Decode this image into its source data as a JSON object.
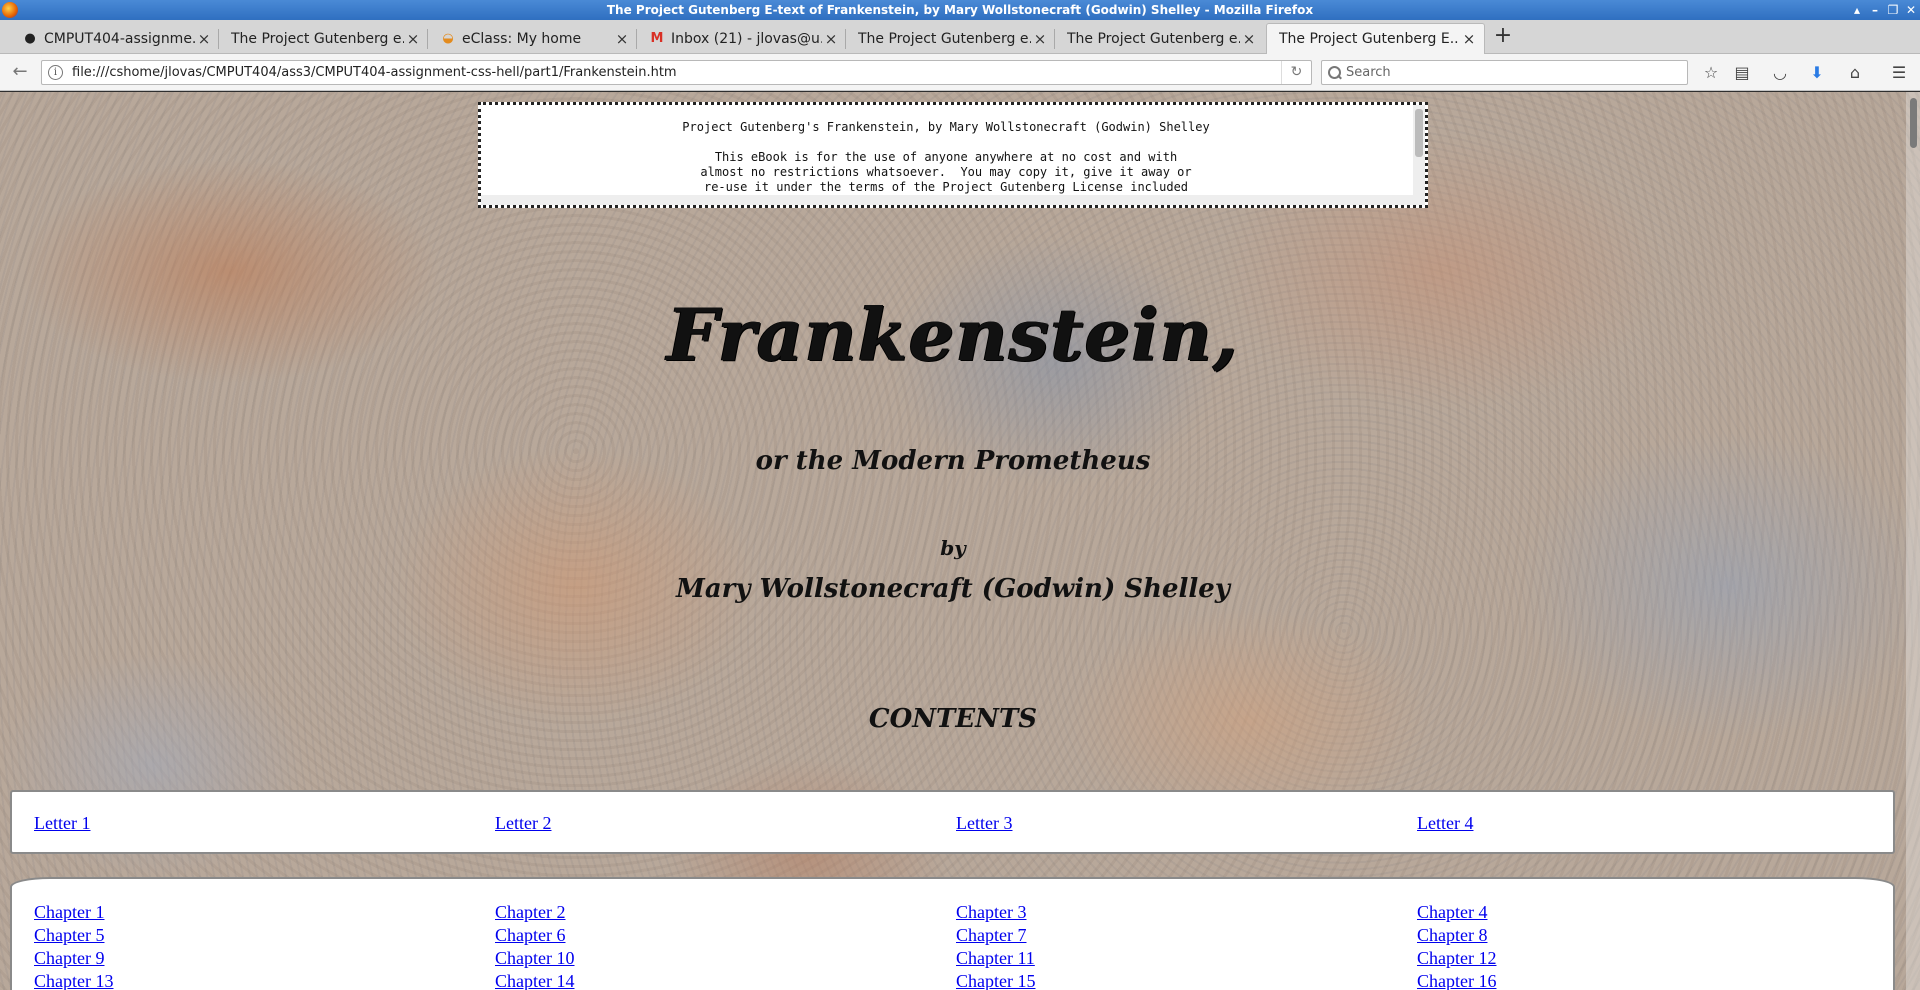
{
  "window": {
    "title": "The Project Gutenberg E-text of Frankenstein, by Mary Wollstonecraft (Godwin) Shelley - Mozilla Firefox"
  },
  "tabs": [
    {
      "title": "CMPUT404-assignme...",
      "icon": "github-icon"
    },
    {
      "title": "The Project Gutenberg e...",
      "icon": "none"
    },
    {
      "title": "eClass: My home",
      "icon": "moodle-icon"
    },
    {
      "title": "Inbox (21) - jlovas@u...",
      "icon": "gmail-icon"
    },
    {
      "title": "The Project Gutenberg e...",
      "icon": "none"
    },
    {
      "title": "The Project Gutenberg e...",
      "icon": "none"
    },
    {
      "title": "The Project Gutenberg E...",
      "icon": "none",
      "active": true
    }
  ],
  "navbar": {
    "url": "file:///cshome/jlovas/CMPUT404/ass3/CMPUT404-assignment-css-hell/part1/Frankenstein.htm",
    "search_placeholder": "Search"
  },
  "page": {
    "license_text": "Project Gutenberg's Frankenstein, by Mary Wollstonecraft (Godwin) Shelley\n\nThis eBook is for the use of anyone anywhere at no cost and with\nalmost no restrictions whatsoever.  You may copy it, give it away or\nre-use it under the terms of the Project Gutenberg License included",
    "title": "Frankenstein,",
    "subtitle": "or the Modern Prometheus",
    "by": "by",
    "author": "Mary Wollstonecraft (Godwin) Shelley",
    "contents_heading": "CONTENTS",
    "letters": [
      "Letter 1",
      "Letter 2",
      "Letter 3",
      "Letter 4"
    ],
    "chapters": [
      "Chapter 1",
      "Chapter 2",
      "Chapter 3",
      "Chapter 4",
      "Chapter 5",
      "Chapter 6",
      "Chapter 7",
      "Chapter 8",
      "Chapter 9",
      "Chapter 10",
      "Chapter 11",
      "Chapter 12",
      "Chapter 13",
      "Chapter 14",
      "Chapter 15",
      "Chapter 16"
    ]
  },
  "colors": {
    "link": "#0000ee",
    "titlebar": "#2f6fc0"
  }
}
